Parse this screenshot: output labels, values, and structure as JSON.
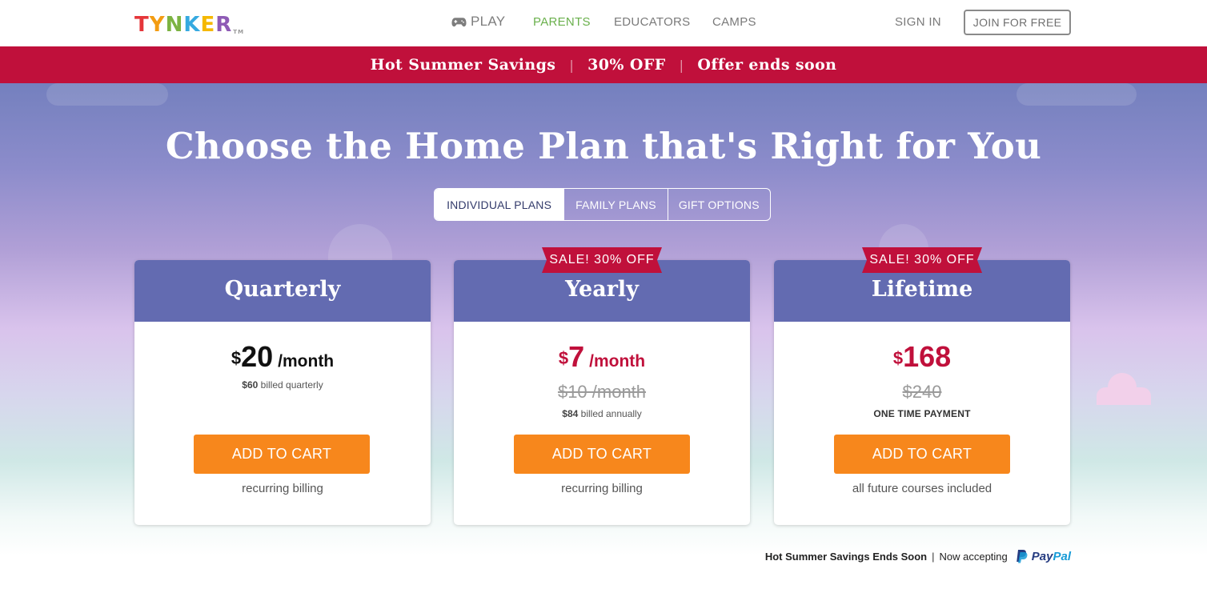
{
  "nav": {
    "logo_letters": [
      {
        "char": "T",
        "color": "#e5363a"
      },
      {
        "char": "Y",
        "color": "#f39c12"
      },
      {
        "char": "N",
        "color": "#7cb342"
      },
      {
        "char": "K",
        "color": "#35a9e0"
      },
      {
        "char": "E",
        "color": "#f5b800"
      },
      {
        "char": "R",
        "color": "#8e5bb5"
      }
    ],
    "logo_tm": "TM",
    "play_label": "PLAY",
    "parents_label": "PARENTS",
    "educators_label": "EDUCATORS",
    "camps_label": "CAMPS",
    "signin_label": "SIGN IN",
    "join_label": "JOIN FOR FREE"
  },
  "promo": {
    "item1": "Hot Summer Savings",
    "item2": "30% OFF",
    "item3": "Offer ends soon",
    "separator": "|"
  },
  "hero": {
    "headline": "Choose the Home Plan that's Right for You"
  },
  "tabs": [
    {
      "label": "INDIVIDUAL PLANS",
      "active": true
    },
    {
      "label": "FAMILY PLANS",
      "active": false
    },
    {
      "label": "GIFT OPTIONS",
      "active": false
    }
  ],
  "plans": [
    {
      "name": "Quarterly",
      "currency": "$",
      "amount": "20",
      "per": "/month",
      "billed_amount": "$60",
      "billed_text": " billed quarterly",
      "cta": "ADD TO CART",
      "note": "recurring billing"
    },
    {
      "name": "Yearly",
      "ribbon": "SALE! 30% OFF",
      "currency": "$",
      "amount": "7",
      "per": "/month",
      "old_price": "$10 /month",
      "billed_amount": "$84",
      "billed_text": " billed annually",
      "cta": "ADD TO CART",
      "note": "recurring billing"
    },
    {
      "name": "Lifetime",
      "ribbon": "SALE! 30% OFF",
      "currency": "$",
      "amount": "168",
      "old_price": "$240",
      "payment_type": "ONE TIME PAYMENT",
      "cta": "ADD TO CART",
      "note": "all future courses included"
    }
  ],
  "footer": {
    "savings_text": "Hot Summer Savings Ends Soon",
    "separator": "|",
    "accepting_text": "Now accepting",
    "paypal_pay": "Pay",
    "paypal_pal": "Pal"
  },
  "colors": {
    "promo_bar": "#c0103b",
    "card_header": "#636bb1",
    "cta": "#f7871c",
    "sale_price": "#c0103b",
    "parents_link": "#6ab04c"
  }
}
